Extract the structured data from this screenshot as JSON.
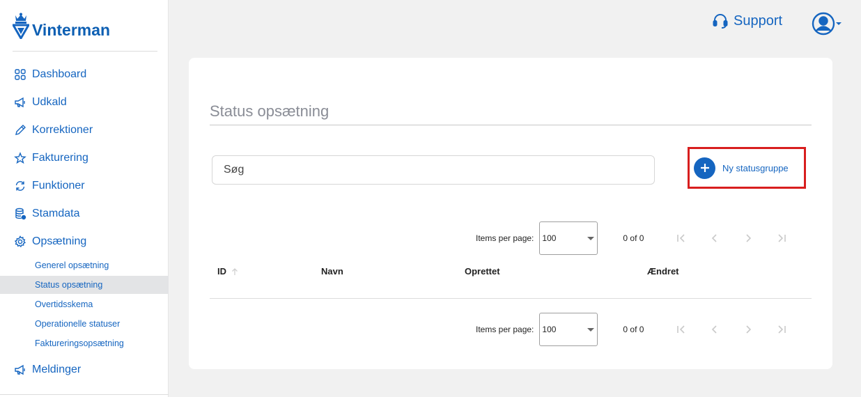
{
  "app": {
    "name": "Vinterman"
  },
  "sidebar": {
    "items": [
      {
        "label": "Dashboard",
        "icon": "grid-icon"
      },
      {
        "label": "Udkald",
        "icon": "megaphone-icon"
      },
      {
        "label": "Korrektioner",
        "icon": "pencil-icon"
      },
      {
        "label": "Fakturering",
        "icon": "star-icon"
      },
      {
        "label": "Funktioner",
        "icon": "refresh-icon"
      },
      {
        "label": "Stamdata",
        "icon": "database-icon"
      },
      {
        "label": "Opsætning",
        "icon": "gear-icon"
      }
    ],
    "subitems": [
      {
        "label": "Generel opsætning"
      },
      {
        "label": "Status opsætning",
        "active": true
      },
      {
        "label": "Overtidsskema"
      },
      {
        "label": "Operationelle statuser"
      },
      {
        "label": "Faktureringsopsætning"
      }
    ],
    "last_item": {
      "label": "Meldinger",
      "icon": "megaphone-icon"
    }
  },
  "topbar": {
    "support_label": "Support"
  },
  "main": {
    "title": "Status opsætning",
    "search": {
      "placeholder": "Søg",
      "value": ""
    },
    "new_button_label": "Ny statusgruppe",
    "paginator": {
      "items_per_page_label": "Items per page:",
      "page_size": "100",
      "range_label": "0 of 0"
    },
    "table": {
      "columns": [
        "ID",
        "Navn",
        "Oprettet",
        "Ændret"
      ]
    }
  },
  "colors": {
    "accent": "#1565c0",
    "highlight_border": "#d81e1e",
    "active_bg": "#e3e4e6"
  }
}
